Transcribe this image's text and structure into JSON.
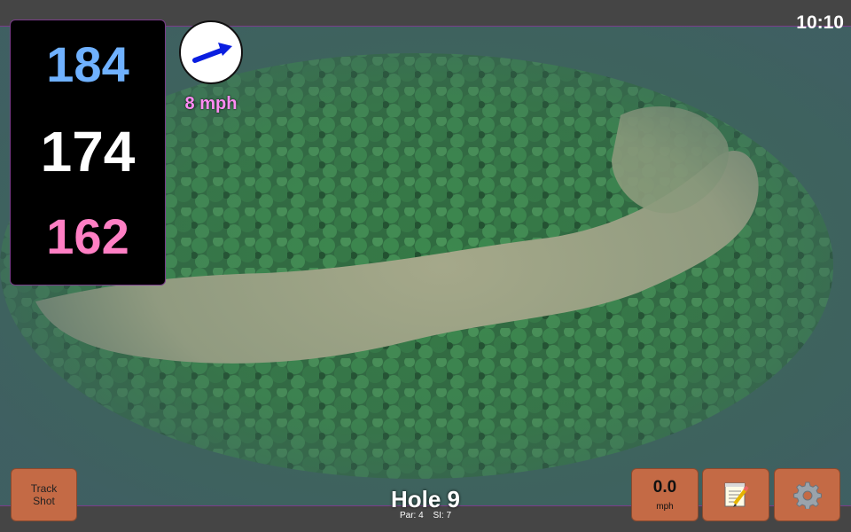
{
  "status_bar": {
    "time": "10:10"
  },
  "distances": {
    "back": "184",
    "middle": "174",
    "front": "162"
  },
  "wind": {
    "speed_label": "8 mph",
    "arrow_icon": "wind-arrow-icon"
  },
  "hole": {
    "title": "Hole 9",
    "par_label": "Par: 4",
    "si_label": "SI: 7"
  },
  "buttons": {
    "track_shot_label": "Track Shot",
    "speed_value": "0.0",
    "speed_unit": "mph",
    "notes_icon": "notepad-icon",
    "settings_icon": "gear-icon"
  },
  "colors": {
    "back_distance": "#6fb1ff",
    "middle_distance": "#ffffff",
    "front_distance": "#ff7fc4",
    "wind_text": "#ff8cf3",
    "button_fill": "#c46a45",
    "accent_line": "#7a3c8a"
  }
}
